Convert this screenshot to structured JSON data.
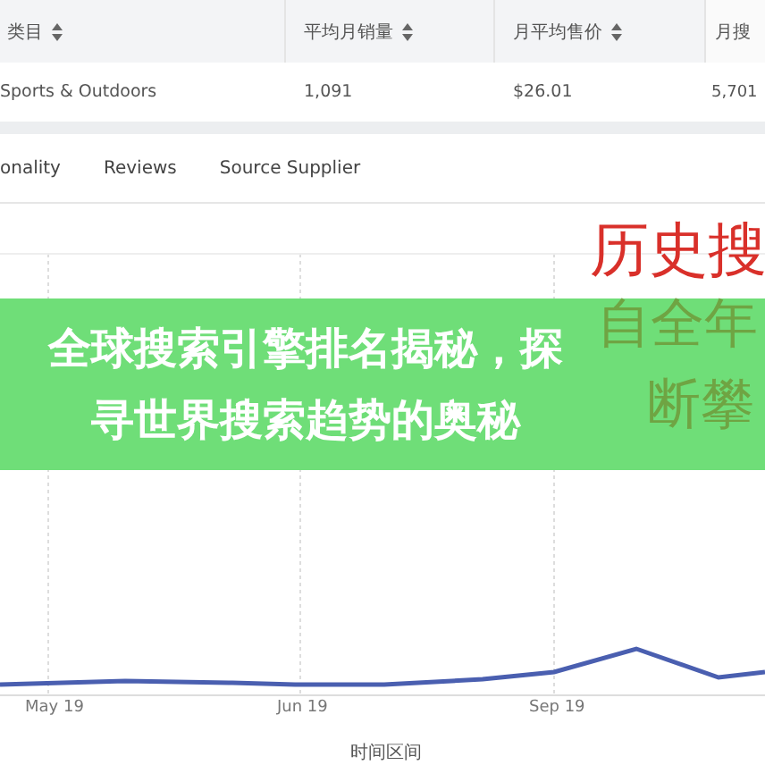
{
  "table": {
    "columns": [
      {
        "label": "类目"
      },
      {
        "label": "平均月销量"
      },
      {
        "label": "月平均售价"
      },
      {
        "label": "月搜"
      }
    ],
    "rows": [
      [
        "Sports & Outdoors",
        "1,091",
        "$26.01",
        "5,701"
      ]
    ]
  },
  "tabs": [
    {
      "label": "onality"
    },
    {
      "label": "Reviews"
    },
    {
      "label": "Source Supplier"
    }
  ],
  "chart": {
    "heading": "历史搜",
    "side_text": [
      "自全年",
      "断攀"
    ],
    "x_labels": [
      "May 19",
      "Jun 19",
      "Sep 19"
    ],
    "x_title": "时间区间"
  },
  "banner": {
    "title": "全球搜索引擎排名揭秘，探寻世界搜索趋势的奥秘"
  }
}
